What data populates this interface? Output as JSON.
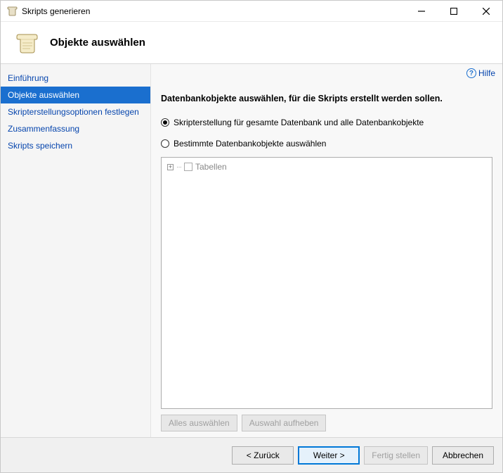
{
  "window": {
    "title": "Skripts generieren"
  },
  "header": {
    "page_title": "Objekte auswählen"
  },
  "sidebar": {
    "items": [
      {
        "label": "Einführung"
      },
      {
        "label": "Objekte auswählen"
      },
      {
        "label": "Skripterstellungsoptionen festlegen"
      },
      {
        "label": "Zusammenfassung"
      },
      {
        "label": "Skripts speichern"
      }
    ]
  },
  "content": {
    "help_label": "Hilfe",
    "instruction": "Datenbankobjekte auswählen, für die Skripts erstellt werden sollen.",
    "radio_all": "Skripterstellung für gesamte Datenbank und alle Datenbankobjekte",
    "radio_specific": "Bestimmte Datenbankobjekte auswählen",
    "tree": {
      "node_tables": "Tabellen"
    },
    "select_all": "Alles auswählen",
    "deselect_all": "Auswahl aufheben"
  },
  "footer": {
    "back": "< Zurück",
    "next": "Weiter >",
    "finish": "Fertig stellen",
    "cancel": "Abbrechen"
  }
}
